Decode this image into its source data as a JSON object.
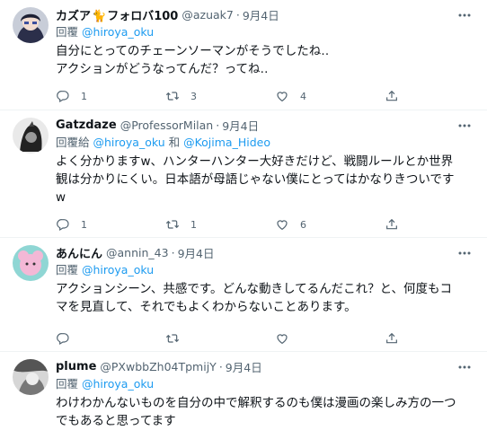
{
  "tweets": [
    {
      "name": "カズア",
      "name_emoji": "🐈",
      "name_suffix": "フォロバ100",
      "handle": "@azuak7",
      "dot": "·",
      "date": "9月4日",
      "reply_prefix": "回覆 ",
      "mentions": [
        "@hiroya_oku"
      ],
      "body_lines": [
        "自分にとってのチェーンソーマンがそうでしたね‥",
        "アクションがどうなってんだ？ってね‥"
      ],
      "replies": "1",
      "retweets": "3",
      "likes": "4"
    },
    {
      "name": "Gatzdaze",
      "handle": "@ProfessorMilan",
      "dot": "·",
      "date": "9月4日",
      "reply_prefix": "回覆給 ",
      "mentions": [
        "@hiroya_oku",
        "@Kojima_Hideo"
      ],
      "joiner": " 和 ",
      "body_lines": [
        "よく分かりますw、ハンターハンター大好きだけど、戦闘ルールとか世界",
        "観は分かりにくい。日本語が母語じゃない僕にとってはかなりきついです",
        "w"
      ],
      "replies": "1",
      "retweets": "1",
      "likes": "6"
    },
    {
      "name": "あんにん",
      "handle": "@annin_43",
      "dot": "·",
      "date": "9月4日",
      "reply_prefix": "回覆 ",
      "mentions": [
        "@hiroya_oku"
      ],
      "body_lines": [
        "アクションシーン、共感です。どんな動きしてるんだこれ？と、何度もコ",
        "マを見直して、それでもよくわからないことあります。"
      ],
      "replies": "",
      "retweets": "",
      "likes": ""
    },
    {
      "name": "plume",
      "handle": "@PXwbbZh04TpmijY",
      "dot": "·",
      "date": "9月4日",
      "reply_prefix": "回覆 ",
      "mentions": [
        "@hiroya_oku"
      ],
      "body_lines": [
        "わけわかんないものを自分の中で解釈するのも僕は漫画の楽しみ方の一つ",
        "でもあると思ってます"
      ]
    }
  ],
  "icons": {
    "reply": "reply-icon",
    "retweet": "retweet-icon",
    "like": "heart-icon",
    "share": "share-icon",
    "more": "more-icon"
  },
  "colors": {
    "accent": "#1d9bf0",
    "secondary_text": "#536471",
    "primary_text": "#0f1419",
    "divider": "#eff3f4"
  }
}
